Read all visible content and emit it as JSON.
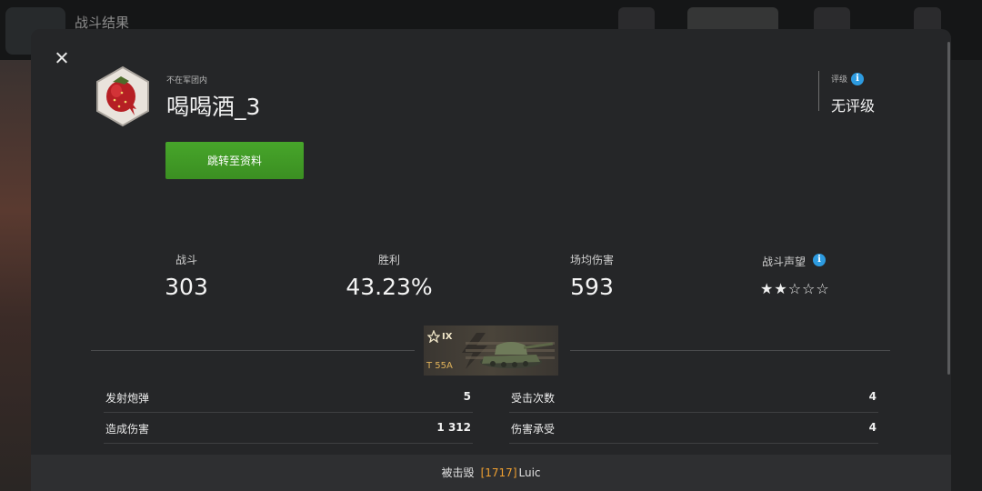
{
  "background": {
    "title": "战斗结果"
  },
  "player": {
    "clan_status": "不在军团内",
    "name": "喝喝酒_3",
    "profile_button_label": "跳转至资料"
  },
  "rating": {
    "label": "评级",
    "value": "无评级"
  },
  "stats": [
    {
      "label": "战斗",
      "value": "303"
    },
    {
      "label": "胜利",
      "value": "43.23%"
    },
    {
      "label": "场均伤害",
      "value": "593"
    },
    {
      "label": "战斗声望",
      "stars": "★★☆☆☆",
      "stars_filled": 2,
      "stars_total": 5
    }
  ],
  "tank": {
    "tier": "IX",
    "name": "T 55A"
  },
  "details": {
    "left": [
      {
        "label": "发射炮弹",
        "value": "5"
      },
      {
        "label": "造成伤害",
        "value": "1 312"
      }
    ],
    "right": [
      {
        "label": "受击次数",
        "value": "4"
      },
      {
        "label": "伤害承受",
        "value": "4"
      }
    ]
  },
  "footer": {
    "prefix": "被击毁",
    "killer_id": "[1717]",
    "killer_name": "Luic"
  },
  "colors": {
    "accent_green": "#47a52a",
    "info_blue": "#2d9be0",
    "killer_orange": "#f0a030",
    "tank_name_gold": "#e0b25a"
  }
}
